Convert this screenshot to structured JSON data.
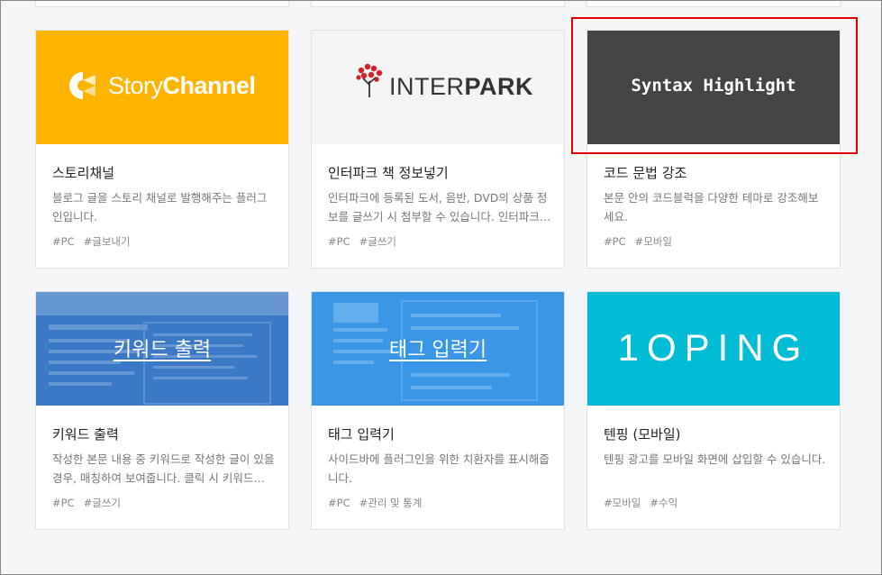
{
  "cards": [
    {
      "title": "스토리채널",
      "desc": "블로그 글을 스토리 채널로 발행해주는 플러그인입니다.",
      "tags": [
        "#PC",
        "#글보내기"
      ],
      "logo": {
        "part1": "Story",
        "part2": "Channel"
      },
      "color": "#ffb400"
    },
    {
      "title": "인터파크 책 정보넣기",
      "desc": "인터파크에 등록된 도서, 음반, DVD의 상품 정보를 글쓰기 시 첨부할 수 있습니다. 인터파크…",
      "tags": [
        "#PC",
        "#글쓰기"
      ],
      "logo": {
        "part1": "INTER",
        "part2": "PARK"
      },
      "color": "#f4f4f4"
    },
    {
      "title": "코드 문법 강조",
      "desc": "본문 안의 코드블럭을 다양한 테마로 강조해보세요.",
      "tags": [
        "#PC",
        "#모바일"
      ],
      "thumb_text": "Syntax Highlight",
      "color": "#444444"
    },
    {
      "title": "키워드 출력",
      "desc": "작성한 본문 내용 중 키워드로 작성한 글이 있을 경우, 매칭하여 보여줍니다. 클릭 시 키워드…",
      "tags": [
        "#PC",
        "#글쓰기"
      ],
      "thumb_text": "키워드 출력",
      "color": "#3b79c6"
    },
    {
      "title": "태그 입력기",
      "desc": "사이드바에 플러그인을 위한 치환자를 표시해줍니다.",
      "tags": [
        "#PC",
        "#관리 및 통계"
      ],
      "thumb_text": "태그 입력기",
      "color": "#3a97e8"
    },
    {
      "title": "텐핑 (모바일)",
      "desc": "텐핑 광고를 모바일 화면에 삽입할 수 있습니다.",
      "tags": [
        "#모바일",
        "#수익"
      ],
      "thumb_text": "1OPING",
      "color": "#00bcd4"
    }
  ],
  "highlight_color": "#e00000"
}
